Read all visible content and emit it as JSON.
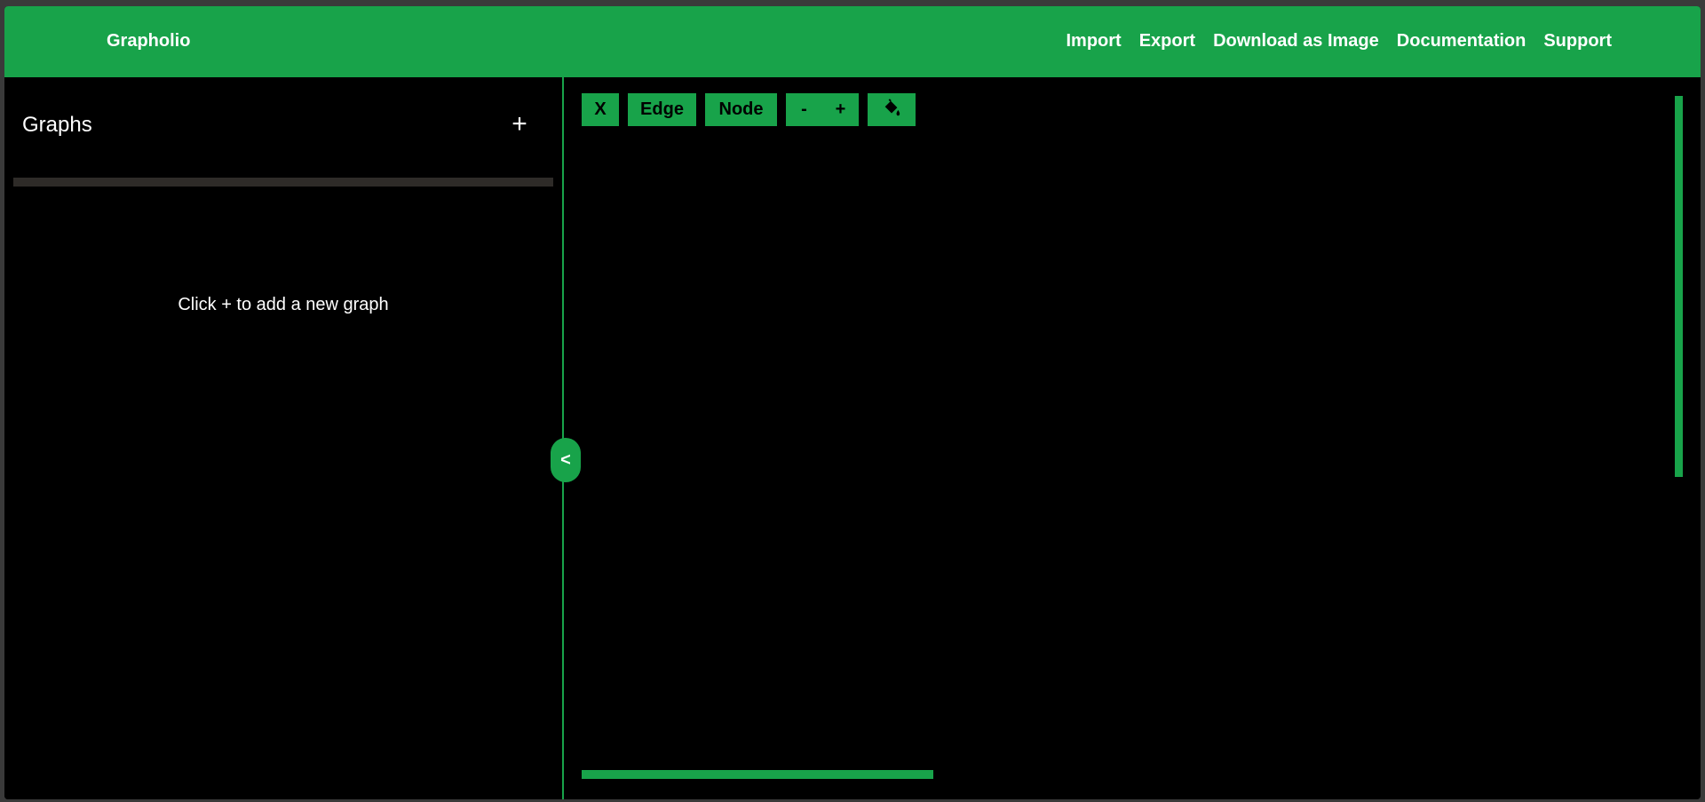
{
  "header": {
    "brand": "Grapholio",
    "nav": [
      "Import",
      "Export",
      "Download as Image",
      "Documentation",
      "Support"
    ]
  },
  "sidebar": {
    "title": "Graphs",
    "add_label": "+",
    "empty_message": "Click + to add a new graph",
    "collapse_label": "<"
  },
  "toolbar": {
    "clear_label": "X",
    "edge_label": "Edge",
    "node_label": "Node",
    "zoom_out_label": "-",
    "zoom_in_label": "+",
    "fill_icon": "paint-bucket-icon"
  },
  "colors": {
    "accent": "#18a34a",
    "background": "#000000",
    "text": "#ffffff"
  }
}
